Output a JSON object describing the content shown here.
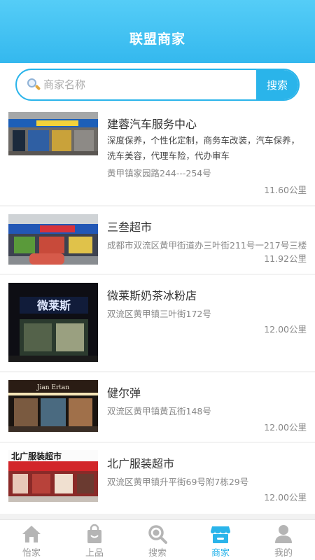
{
  "header": {
    "title": "联盟商家"
  },
  "search": {
    "placeholder": "商家名称",
    "value": "",
    "button_label": "搜索"
  },
  "merchants": [
    {
      "name": "建蓉汽车服务中心",
      "description": "深度保养，个性化定制，商务车改装，汽车保养，洗车美容，代理车险，代办审车",
      "address": "黄甲镇家园路244---254号",
      "distance": "11.60公里"
    },
    {
      "name": "三叁超市",
      "address": "成都市双流区黄甲街道办三叶街211号一217号三楼",
      "distance": "11.92公里"
    },
    {
      "name": "微莱斯奶茶冰粉店",
      "address": "双流区黄甲镇三叶街172号",
      "distance": "12.00公里",
      "sign_text": "微莱斯"
    },
    {
      "name": "健尔弹",
      "address": "双流区黄甲镇黄瓦街148号",
      "distance": "12.00公里",
      "sign_text": "Jian  Ertan"
    },
    {
      "name": "北广服装超市",
      "address": "双流区黄甲镇升平街69号附7栋29号",
      "distance": "12.00公里",
      "sign_text": "北广服装超市"
    }
  ],
  "tabbar": {
    "items": [
      {
        "label": "怡家",
        "icon": "home-icon"
      },
      {
        "label": "上品",
        "icon": "shopping-bag-icon"
      },
      {
        "label": "搜索",
        "icon": "search-icon"
      },
      {
        "label": "商家",
        "icon": "shop-icon",
        "active": true
      },
      {
        "label": "我的",
        "icon": "person-icon"
      }
    ]
  },
  "colors": {
    "accent": "#2ab4ea",
    "header": "#45c2f3",
    "inactive": "#9a9a9a"
  }
}
